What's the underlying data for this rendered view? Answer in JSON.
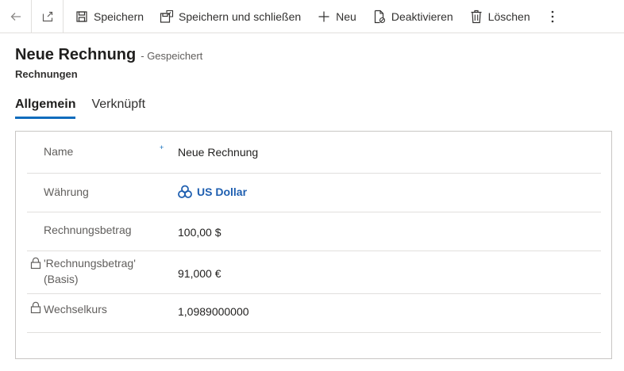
{
  "toolbar": {
    "save": "Speichern",
    "save_close": "Speichern und schließen",
    "new": "Neu",
    "deactivate": "Deaktivieren",
    "delete": "Löschen"
  },
  "header": {
    "title": "Neue Rechnung",
    "status": "- Gespeichert",
    "entity": "Rechnungen"
  },
  "tabs": [
    {
      "label": "Allgemein",
      "active": true
    },
    {
      "label": "Verknüpft",
      "active": false
    }
  ],
  "fields": {
    "name": {
      "label": "Name",
      "required_marker": "+",
      "value": "Neue Rechnung"
    },
    "currency": {
      "label": "Währung",
      "value": "US Dollar"
    },
    "amount": {
      "label": "Rechnungsbetrag",
      "value": "100,00 $"
    },
    "amount_base": {
      "label_line1": "'Rechnungsbetrag'",
      "label_line2": "(Basis)",
      "value": "91,000 €"
    },
    "exchange_rate": {
      "label": "Wechselkurs",
      "value": "1,0989000000"
    }
  },
  "colors": {
    "accent": "#0f6cbd",
    "link": "#1f5fb0"
  }
}
